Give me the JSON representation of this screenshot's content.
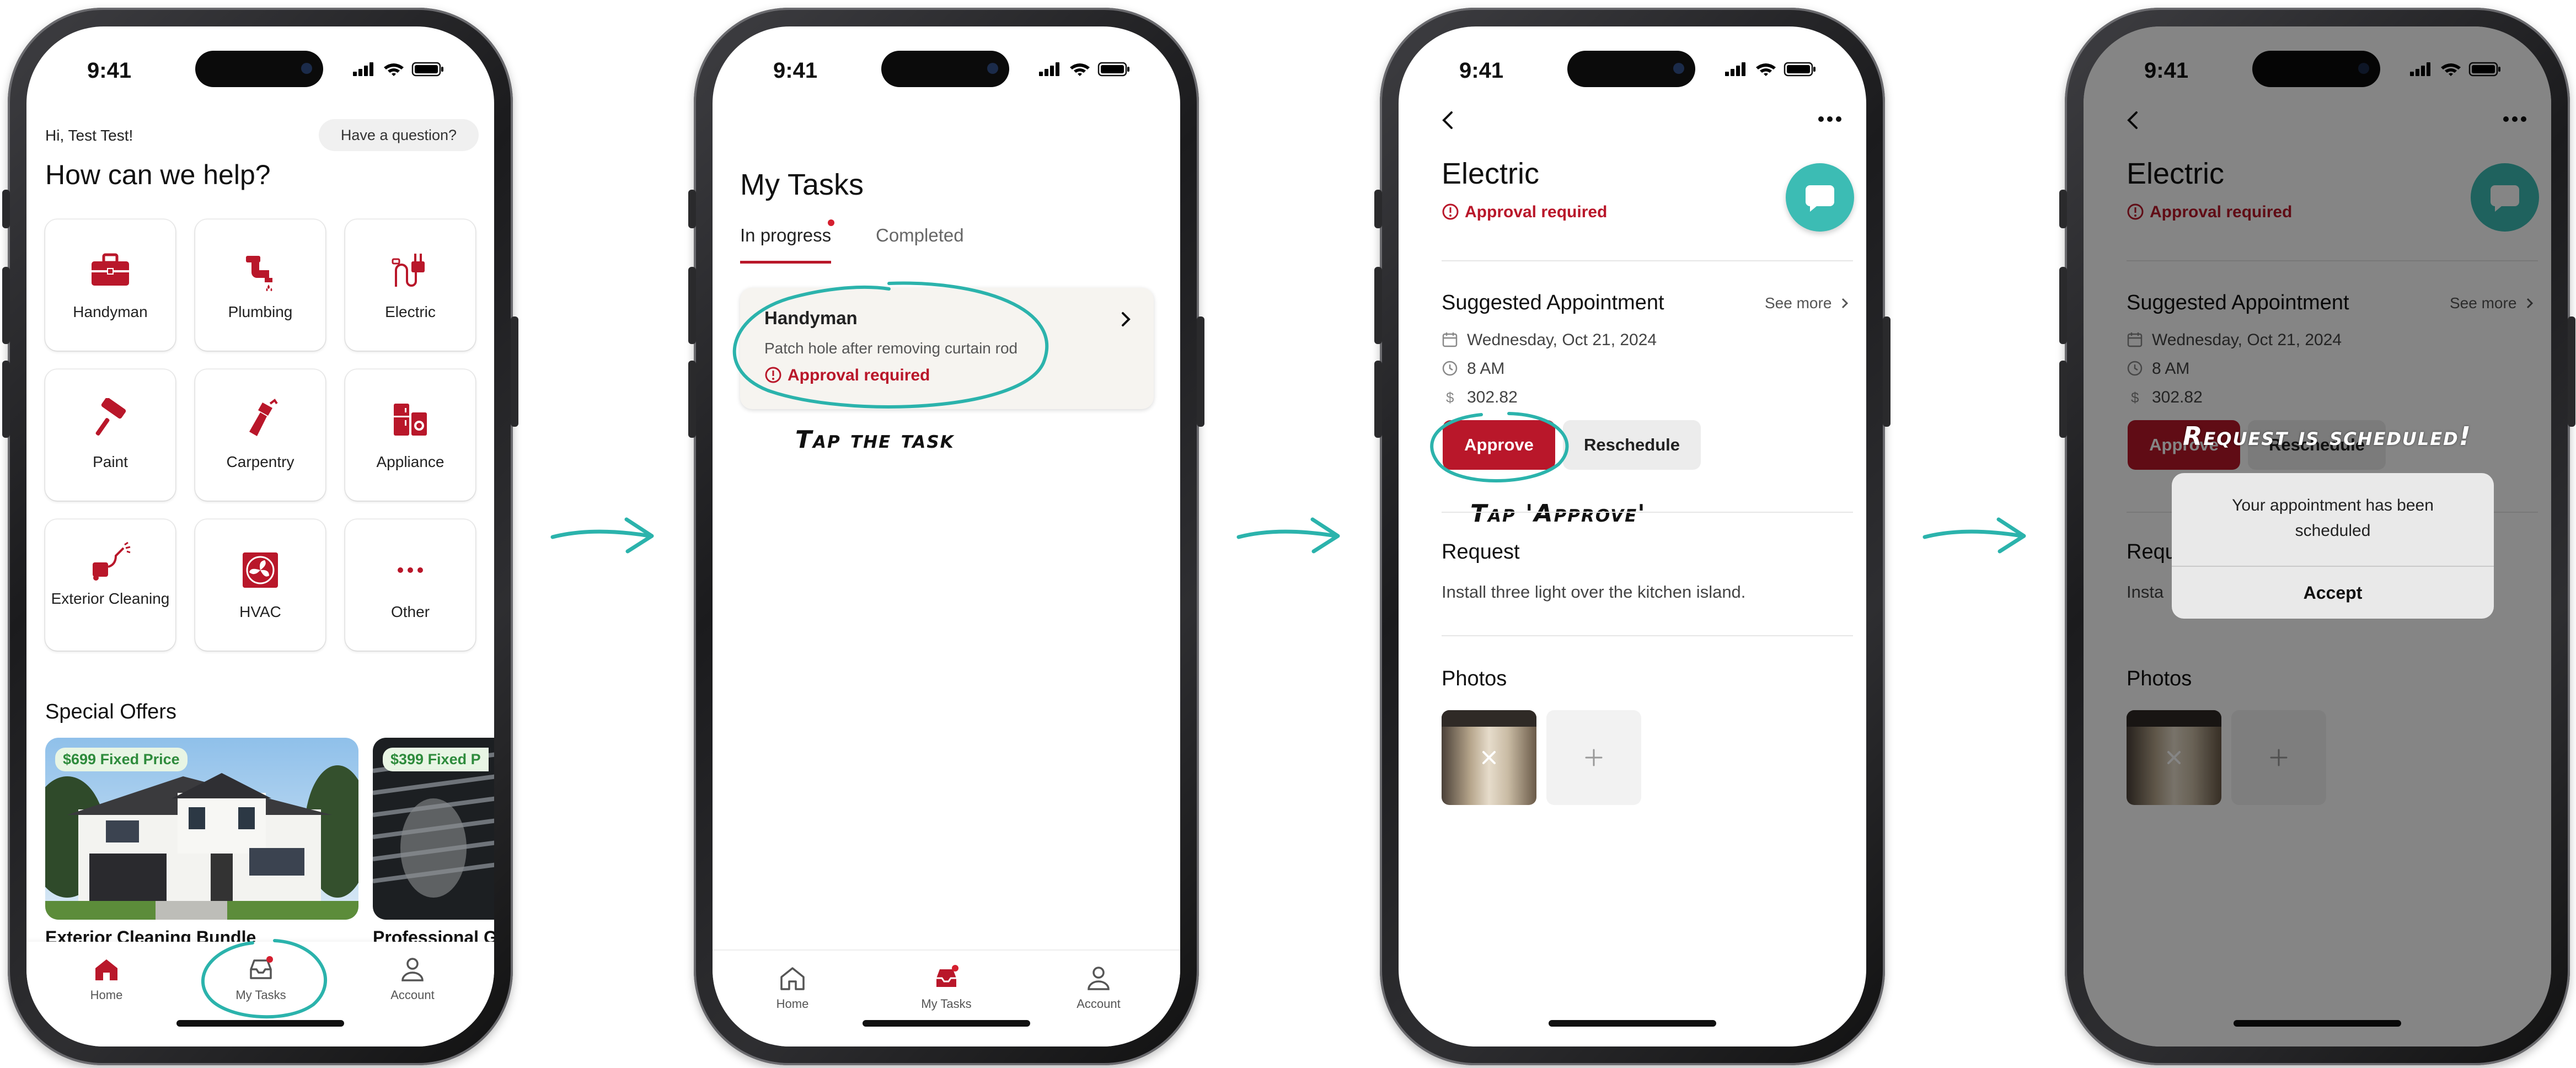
{
  "colors": {
    "brand_red": "#b9172a",
    "teal": "#2bb3ac",
    "offer_green": "#2e8b3c"
  },
  "status_bar": {
    "time": "9:41"
  },
  "screen1": {
    "greeting": "Hi, Test Test!",
    "question_button": "Have a question?",
    "heading": "How can we help?",
    "categories": [
      {
        "label": "Handyman",
        "icon": "toolbox-icon"
      },
      {
        "label": "Plumbing",
        "icon": "faucet-icon"
      },
      {
        "label": "Electric",
        "icon": "plug-icon"
      },
      {
        "label": "Paint",
        "icon": "paint-roller-icon"
      },
      {
        "label": "Carpentry",
        "icon": "hammer-icon"
      },
      {
        "label": "Appliance",
        "icon": "appliance-icon"
      },
      {
        "label": "Exterior Cleaning",
        "icon": "power-washer-icon"
      },
      {
        "label": "HVAC",
        "icon": "fan-icon"
      },
      {
        "label": "Other",
        "icon": "more-dots-icon"
      }
    ],
    "special_offers_title": "Special Offers",
    "offers": [
      {
        "badge": "$699 Fixed Price",
        "title": "Exterior Cleaning Bundle"
      },
      {
        "badge": "$399 Fixed P",
        "title": "Professional G"
      }
    ],
    "nav": {
      "home": "Home",
      "tasks": "My Tasks",
      "account": "Account"
    }
  },
  "screen2": {
    "title": "My Tasks",
    "tabs": {
      "in_progress": "In progress",
      "completed": "Completed"
    },
    "task": {
      "title": "Handyman",
      "description": "Patch hole after removing curtain rod",
      "status": "Approval required"
    },
    "annotation": "Tap the task",
    "nav": {
      "home": "Home",
      "tasks": "My Tasks",
      "account": "Account"
    }
  },
  "screen3": {
    "title": "Electric",
    "status": "Approval required",
    "section_title": "Suggested Appointment",
    "see_more": "See more",
    "date": "Wednesday, Oct 21, 2024",
    "time": "8 AM",
    "price": "302.82",
    "approve": "Approve",
    "reschedule": "Reschedule",
    "annotation": "Tap 'Approve'",
    "request_title": "Request",
    "request_text": "Install three light over the kitchen island.",
    "photos_title": "Photos"
  },
  "screen4": {
    "title": "Electric",
    "status": "Approval required",
    "section_title": "Suggested Appointment",
    "see_more": "See more",
    "date": "Wednesday, Oct 21, 2024",
    "time": "8 AM",
    "price": "302.82",
    "approve": "Approve",
    "reschedule": "Reschedule",
    "request_title": "Requ",
    "request_text": "Insta",
    "photos_title": "Photos",
    "annotation": "Request is scheduled!",
    "dialog": {
      "message": "Your appointment has been scheduled",
      "accept": "Accept"
    }
  }
}
